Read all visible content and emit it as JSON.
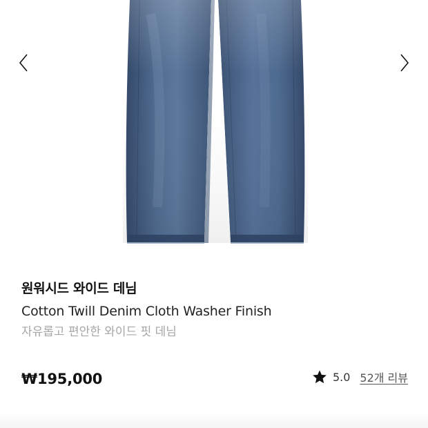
{
  "product": {
    "name_ko": "원워시드 와이드 데님",
    "name_en": "Cotton Twill Denim Cloth Washer Finish",
    "description": "자유롭고 편안한 와이드 핏 데님",
    "price": "₩195,000",
    "rating": "5.0",
    "reviews_label": "52개 리뷰"
  },
  "gallery": {
    "prev_icon": "chevron-left-icon",
    "next_icon": "chevron-right-icon",
    "image": "denim-jeans-image"
  },
  "colors": {
    "denim_dark": "#3a5373",
    "denim_mid": "#4f6b8f",
    "denim_light": "#6f89a9",
    "text_primary": "#111111",
    "text_muted": "#a6a6a6"
  }
}
